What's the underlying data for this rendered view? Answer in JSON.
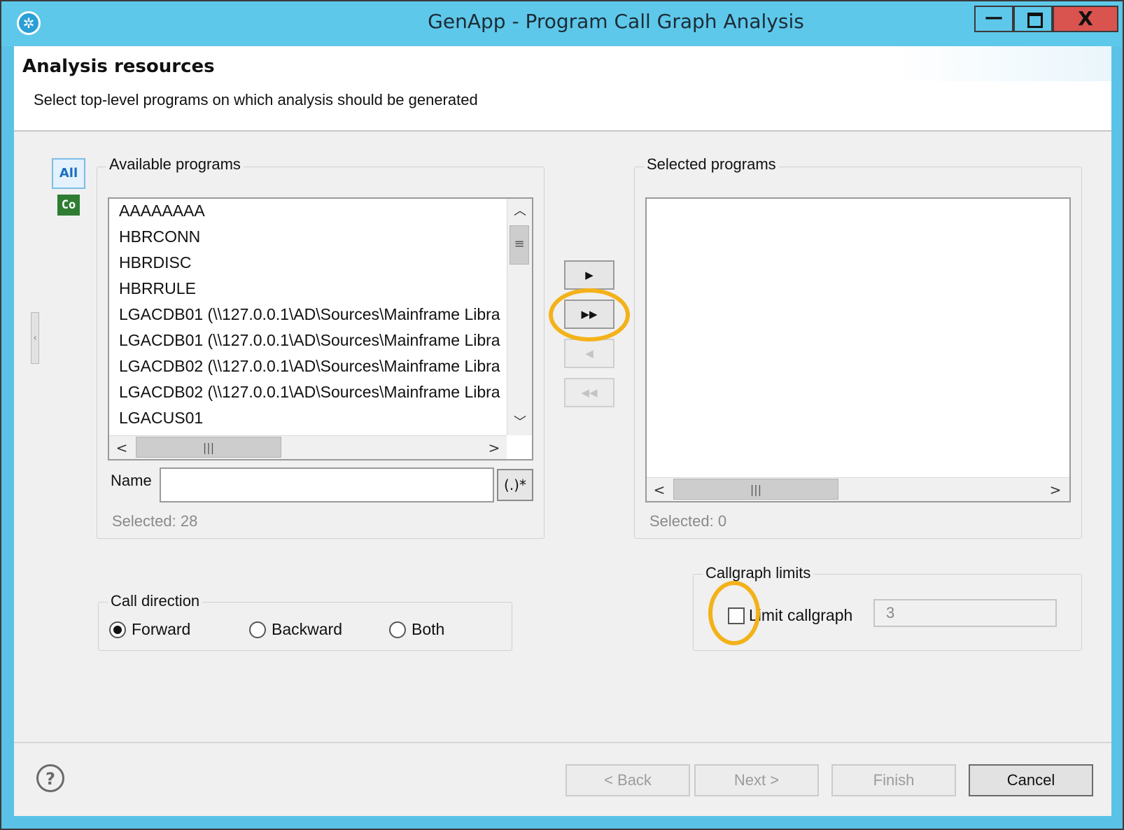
{
  "window": {
    "title": "GenApp  -  Program Call Graph Analysis",
    "buttons": {
      "minimize": "—",
      "close": "X"
    }
  },
  "header": {
    "title": "Analysis resources",
    "description": "Select top-level programs on which analysis should be generated"
  },
  "toolbar": {
    "all_label": "All",
    "co_label": "Co"
  },
  "available": {
    "label": "Available programs",
    "items": [
      "AAAAAAAA",
      "HBRCONN",
      "HBRDISC",
      "HBRRULE",
      "LGACDB01 (\\\\127.0.0.1\\AD\\Sources\\Mainframe Libra",
      "LGACDB01 (\\\\127.0.0.1\\AD\\Sources\\Mainframe Libra",
      "LGACDB02 (\\\\127.0.0.1\\AD\\Sources\\Mainframe Libra",
      "LGACDB02 (\\\\127.0.0.1\\AD\\Sources\\Mainframe Libra",
      "LGACUS01"
    ],
    "name_label": "Name",
    "name_value": "",
    "regex_label": "(.)*",
    "selected_count": "Selected: 28"
  },
  "selected": {
    "label": "Selected programs",
    "items": [],
    "selected_count": "Selected: 0"
  },
  "transfer": {
    "add": "▶",
    "add_all": "▶▶",
    "remove": "◀",
    "remove_all": "◀◀"
  },
  "call_direction": {
    "label": "Call direction",
    "options": [
      "Forward",
      "Backward",
      "Both"
    ],
    "selected": "Forward"
  },
  "callgraph_limits": {
    "label": "Callgraph limits",
    "checkbox_label": "Limit callgraph",
    "checked": false,
    "limit_value": "3"
  },
  "footer": {
    "help": "?",
    "back": "< Back",
    "next": "Next >",
    "finish": "Finish",
    "cancel": "Cancel"
  },
  "colors": {
    "titlebar": "#5ec8ea",
    "close_button": "#d9534f",
    "highlight_ring": "#f3b21a"
  }
}
